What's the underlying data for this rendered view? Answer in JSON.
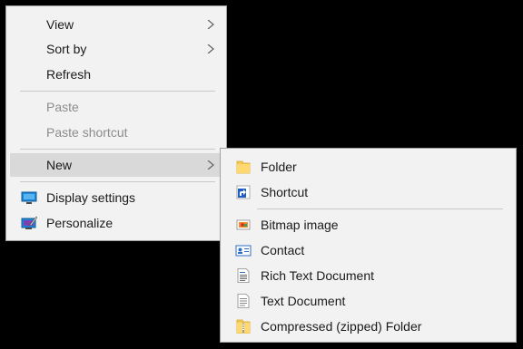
{
  "context_menu": {
    "items": [
      {
        "label": "View"
      },
      {
        "label": "Sort by"
      },
      {
        "label": "Refresh"
      },
      {
        "label": "Paste"
      },
      {
        "label": "Paste shortcut"
      },
      {
        "label": "New"
      },
      {
        "label": "Display settings",
        "icon": "display-settings-icon"
      },
      {
        "label": "Personalize",
        "icon": "personalize-icon"
      }
    ]
  },
  "new_submenu": {
    "items": [
      {
        "label": "Folder",
        "icon": "folder-icon"
      },
      {
        "label": "Shortcut",
        "icon": "shortcut-icon"
      },
      {
        "label": "Bitmap image",
        "icon": "bitmap-image-icon"
      },
      {
        "label": "Contact",
        "icon": "contact-icon"
      },
      {
        "label": "Rich Text Document",
        "icon": "rich-text-document-icon"
      },
      {
        "label": "Text Document",
        "icon": "text-document-icon"
      },
      {
        "label": "Compressed (zipped) Folder",
        "icon": "zipped-folder-icon"
      }
    ]
  },
  "colors": {
    "menu_background": "#f2f2f2",
    "menu_border": "#a0a0a0",
    "highlight": "#d9d9d9",
    "disabled_text": "#8c8c8c",
    "text": "#1a1a1a",
    "desktop_background": "#000000"
  }
}
